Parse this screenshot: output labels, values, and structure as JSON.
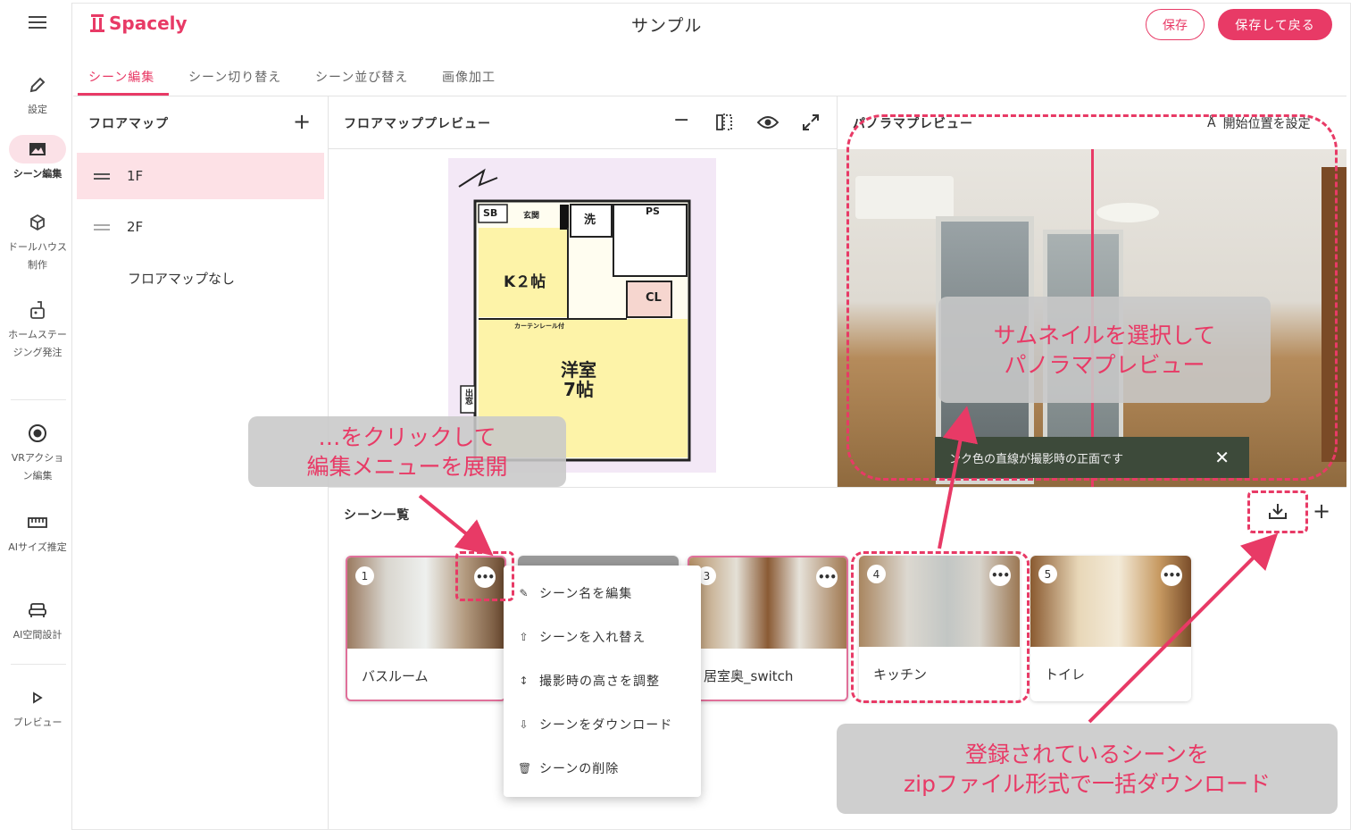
{
  "app": {
    "logo": "Spacely",
    "title": "サンプル"
  },
  "header": {
    "save_label": "保存",
    "save_back_label": "保存して戻る"
  },
  "rail": {
    "items": [
      {
        "label": "設定"
      },
      {
        "label": "シーン編集"
      },
      {
        "label": "ドールハウス制作"
      },
      {
        "label": "ホームステージング発注"
      },
      {
        "label": "VRアクション編集"
      },
      {
        "label": "AIサイズ推定"
      },
      {
        "label": "AI空間設計"
      },
      {
        "label": "プレビュー"
      }
    ]
  },
  "tabs": [
    {
      "label": "シーン編集"
    },
    {
      "label": "シーン切り替え"
    },
    {
      "label": "シーン並び替え"
    },
    {
      "label": "画像加工"
    }
  ],
  "floormap": {
    "title": "フロアマップ",
    "floors": [
      {
        "label": "1F"
      },
      {
        "label": "2F"
      }
    ],
    "none_label": "フロアマップなし"
  },
  "preview": {
    "title": "フロアマッププレビュー",
    "plan": {
      "sb": "SB",
      "genkan": "玄関",
      "sen": "洗",
      "ps": "PS",
      "k": "K２帖",
      "cl": "CL",
      "curtain": "カーテンレール付",
      "room": "洋室\n7帖",
      "demado": "出窓"
    }
  },
  "panorama": {
    "title": "パノラマプレビュー",
    "start_label": "開始位置を設定",
    "toast": "ンク色の直線が撮影時の正面です"
  },
  "scenes": {
    "title": "シーン一覧",
    "items": [
      {
        "num": "1",
        "name": "バスルーム"
      },
      {
        "num": "3",
        "name": "居室奥_switch"
      },
      {
        "num": "4",
        "name": "キッチン"
      },
      {
        "num": "5",
        "name": "トイレ"
      }
    ]
  },
  "menu": {
    "items": [
      {
        "label": "シーン名を編集"
      },
      {
        "label": "シーンを入れ替え"
      },
      {
        "label": "撮影時の高さを調整"
      },
      {
        "label": "シーンをダウンロード"
      },
      {
        "label": "シーンの削除"
      }
    ]
  },
  "callouts": {
    "panorama": [
      "サムネイルを選択して",
      "パノラマプレビュー"
    ],
    "menu": [
      "…をクリックして",
      "編集メニューを展開"
    ],
    "download": [
      "登録されているシーンを",
      "zipファイル形式で一括ダウンロード"
    ]
  },
  "colors": {
    "accent": "#e83a66",
    "selected_bg": "#fde1e6"
  }
}
